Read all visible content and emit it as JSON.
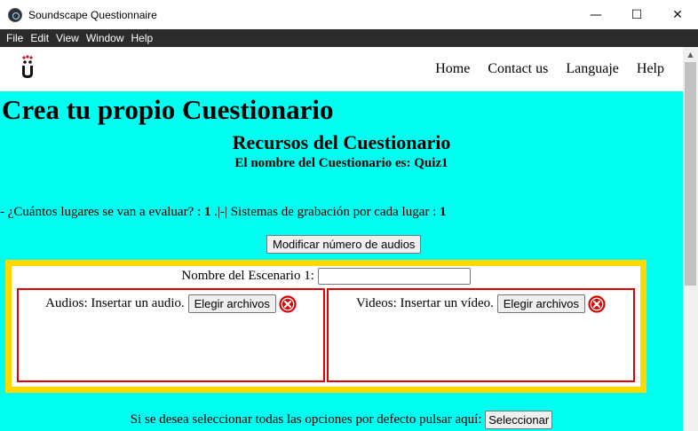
{
  "window": {
    "title": "Soundscape Questionnaire",
    "controls": {
      "minimize": "—",
      "maximize": "☐",
      "close": "✕"
    }
  },
  "menu": [
    "File",
    "Edit",
    "View",
    "Window",
    "Help"
  ],
  "nav": {
    "logo_icon": "university-logo-icon",
    "links": [
      "Home",
      "Contact us",
      "Languaje",
      "Help"
    ]
  },
  "page": {
    "title": "Crea tu propio Cuestionario",
    "section_title": "Recursos del Cuestionario",
    "quiz_name_label": "El nombre del Cuestionario es: Quiz1",
    "places_question": "- ¿Cuántos lugares se van a evaluar? : ",
    "places_value": "1",
    "separator": " .|-| ",
    "systems_question": "Sistemas de grabación por cada lugar : ",
    "systems_value": "1",
    "modify_button": "Modificar número de audios"
  },
  "scenario": {
    "name_label": "Nombre del Escenario 1: ",
    "name_value": "",
    "audio_label": "Audios: Insertar un audio. ",
    "audio_button": "Elegir archivos",
    "video_label": "Videos: Insertar un vídeo. ",
    "video_button": "Elegir archivos"
  },
  "footer": {
    "default_text": "Si se desea seleccionar todas las opciones por defecto pulsar aquí: ",
    "select_button": "Seleccionar"
  },
  "colors": {
    "background": "#00fff0",
    "scenario_border": "#ffd800",
    "panel_border": "#e00000",
    "remove_icon": "#e00000",
    "menubar": "#2b2b2b"
  }
}
